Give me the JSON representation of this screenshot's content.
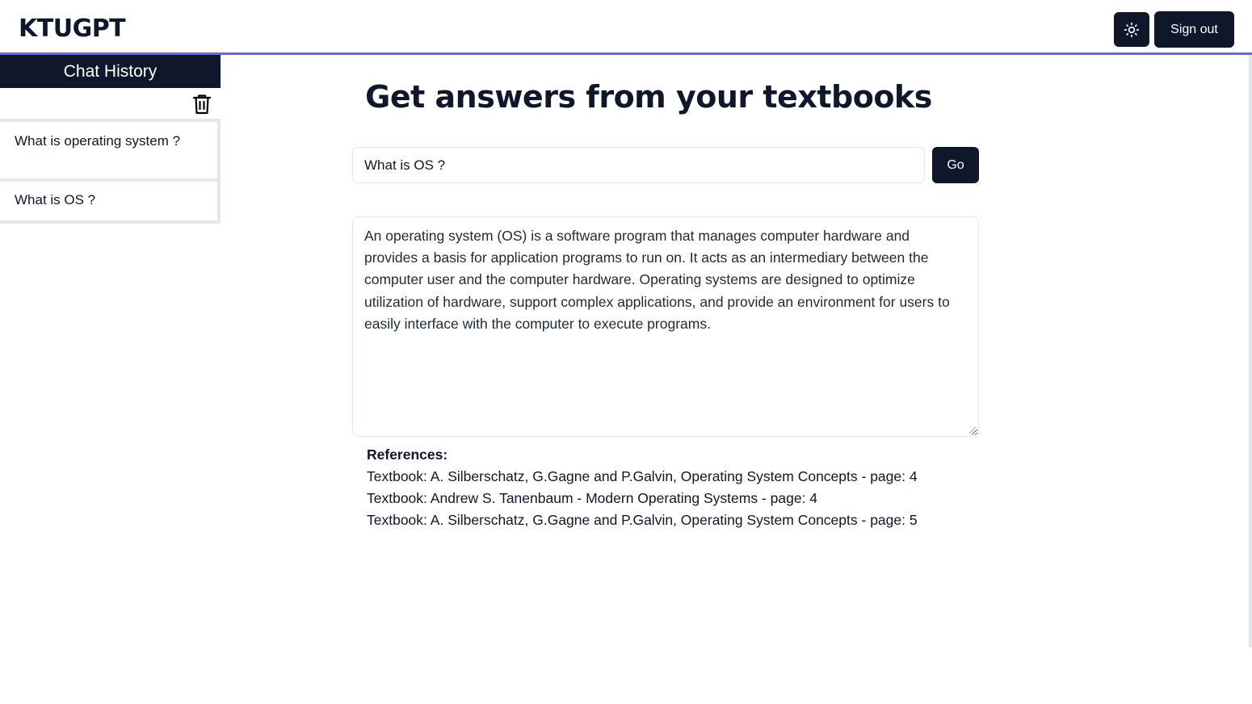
{
  "header": {
    "logo": "KTUGPT",
    "theme_icon": "sun-icon",
    "sign_out_label": "Sign out"
  },
  "sidebar": {
    "title": "Chat History",
    "delete_icon": "trash-icon",
    "items": [
      {
        "label": "What is operating system ?"
      },
      {
        "label": "What is OS ?"
      }
    ]
  },
  "main": {
    "title": "Get answers from your textbooks",
    "query_value": "What is OS ?",
    "go_label": "Go",
    "answer": "An operating system (OS) is a software program that manages computer hardware and provides a basis for application programs to run on. It acts as an intermediary between the computer user and the computer hardware. Operating systems are designed to optimize utilization of hardware, support complex applications, and provide an environment for users to easily interface with the computer to execute programs.",
    "references": {
      "heading": "References:",
      "items": [
        "Textbook: A. Silberschatz, G.Gagne and P.Galvin, Operating System Concepts - page: 4",
        "Textbook: Andrew S. Tanenbaum - Modern Operating Systems - page: 4",
        "Textbook: A. Silberschatz, G.Gagne and P.Galvin, Operating System Concepts - page: 5"
      ]
    }
  },
  "colors": {
    "primary_dark": "#0f172a",
    "accent_line": "#6366f1"
  }
}
